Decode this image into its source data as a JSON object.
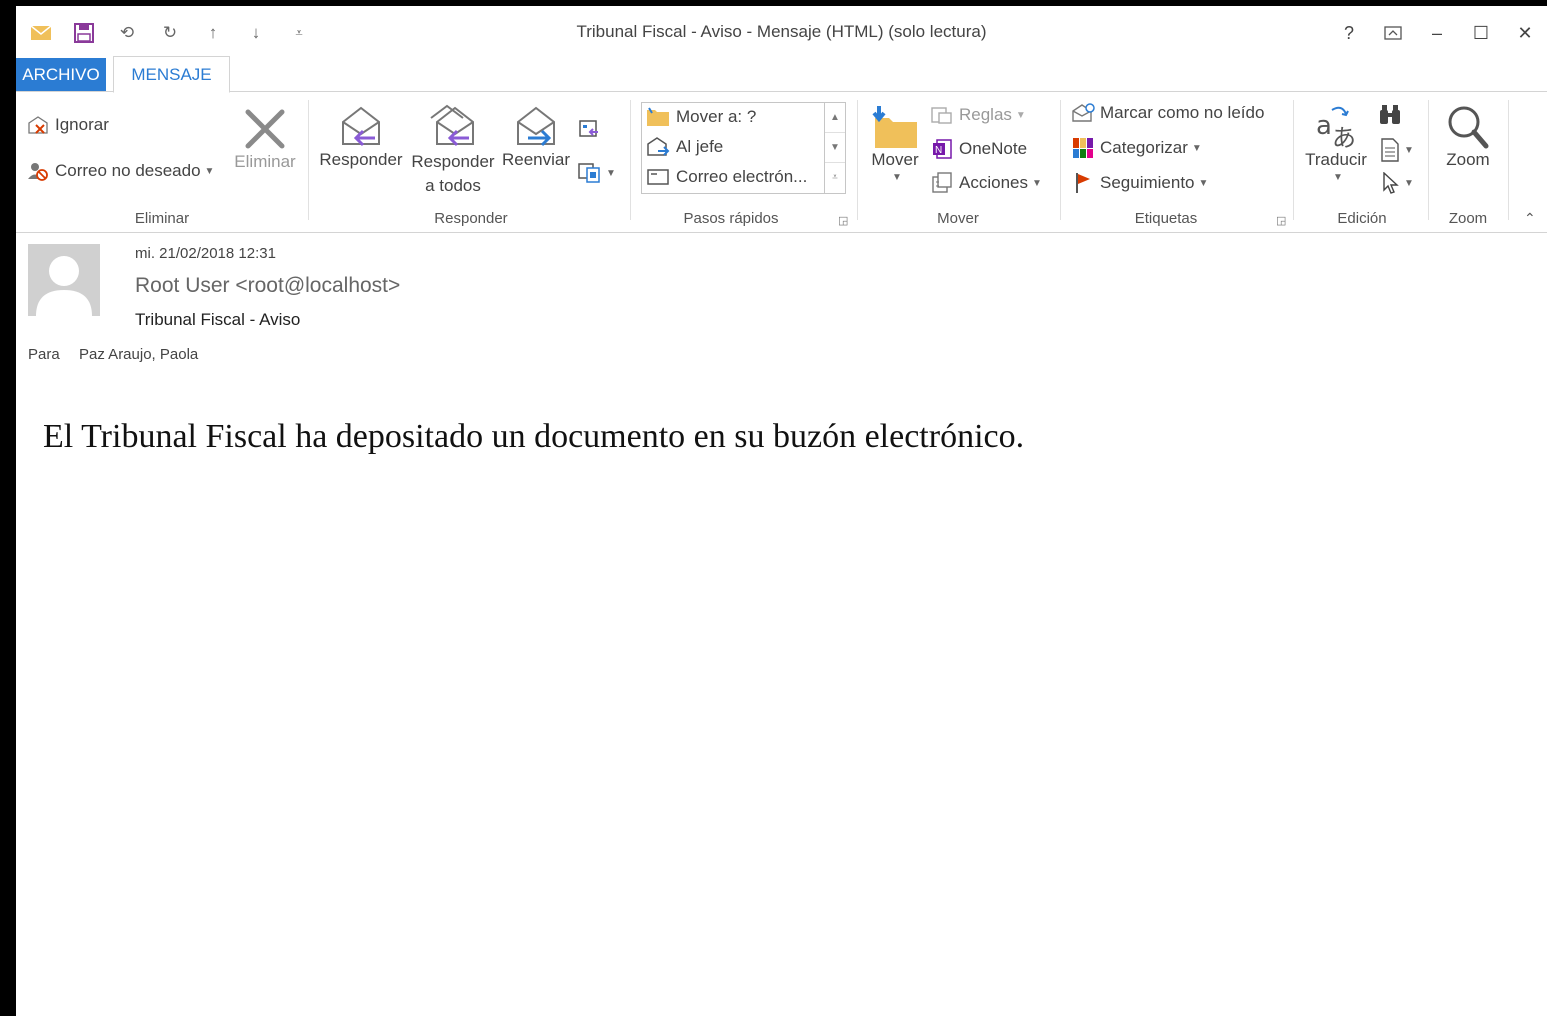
{
  "window": {
    "title": "Tribunal Fiscal - Aviso - Mensaje (HTML) (solo lectura)",
    "controls": {
      "help": "?",
      "restore_ribbon": "⊼",
      "minimize": "–",
      "maximize": "☐",
      "close": "✕"
    }
  },
  "quick_access": [
    "mail-icon",
    "save-icon",
    "undo-icon",
    "redo-icon",
    "up-arrow-icon",
    "down-arrow-icon",
    "customize-icon"
  ],
  "tabs": {
    "file": "ARCHIVO",
    "message": "MENSAJE"
  },
  "ribbon": {
    "eliminar": {
      "label": "Eliminar",
      "ignorar": "Ignorar",
      "correo_no_deseado": "Correo no deseado",
      "eliminar": "Eliminar"
    },
    "responder": {
      "label": "Responder",
      "responder": "Responder",
      "responder_todos_1": "Responder",
      "responder_todos_2": "a todos",
      "reenviar": "Reenviar"
    },
    "pasos_rapidos": {
      "label": "Pasos rápidos",
      "items": [
        "Mover a: ?",
        "Al jefe",
        "Correo electrón..."
      ]
    },
    "mover": {
      "label": "Mover",
      "mover": "Mover",
      "reglas": "Reglas",
      "onenote": "OneNote",
      "acciones": "Acciones"
    },
    "etiquetas": {
      "label": "Etiquetas",
      "marcar": "Marcar como no leído",
      "categorizar": "Categorizar",
      "seguimiento": "Seguimiento"
    },
    "edicion": {
      "label": "Edición",
      "traducir": "Traducir"
    },
    "zoom": {
      "label": "Zoom",
      "zoom": "Zoom"
    }
  },
  "message": {
    "date": "mi. 21/02/2018 12:31",
    "from": "Root User <root@localhost>",
    "subject": "Tribunal Fiscal - Aviso",
    "to_label": "Para",
    "to_value": "Paz Araujo, Paola",
    "body": "El Tribunal Fiscal ha depositado un documento en su buzón electrónico."
  },
  "colors": {
    "accent": "#2b7cd3",
    "folder": "#f0c05a",
    "reply_arrow": "#8a5bd6",
    "forward_arrow": "#2b7cd3",
    "flag": "#d83b01"
  }
}
